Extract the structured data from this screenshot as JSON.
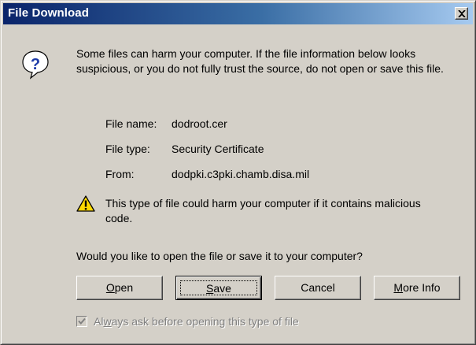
{
  "window": {
    "title": "File Download",
    "close_symbol": "×"
  },
  "message": "Some files can harm your computer. If the file information below looks suspicious, or you do not fully trust the source, do not open or save this file.",
  "file_info": {
    "name_label": "File name:",
    "name_value": "dodroot.cer",
    "type_label": "File type:",
    "type_value": "Security Certificate",
    "from_label": "From:",
    "from_value": "dodpki.c3pki.chamb.disa.mil"
  },
  "warning": "This type of file could harm your computer if it contains malicious code.",
  "question": "Would you like to open the file or save it to your computer?",
  "buttons": {
    "open": {
      "mnemonic": "O",
      "rest": "pen"
    },
    "save": {
      "mnemonic": "S",
      "rest": "ave"
    },
    "cancel": "Cancel",
    "more_info": {
      "mnemonic": "M",
      "rest": "ore Info"
    }
  },
  "checkbox": {
    "checked": true,
    "enabled": false,
    "label_prefix": "Al",
    "label_mnemonic": "w",
    "label_suffix": "ays ask before opening this type of file"
  },
  "icons": {
    "question": "question-icon",
    "warning": "warning-icon",
    "close": "close-icon"
  },
  "colors": {
    "titlebar_start": "#0a246a",
    "titlebar_end": "#a6caf0",
    "dialog_face": "#d4d0c8",
    "warning_yellow": "#ffd800",
    "question_blue": "#1c3aa8"
  }
}
